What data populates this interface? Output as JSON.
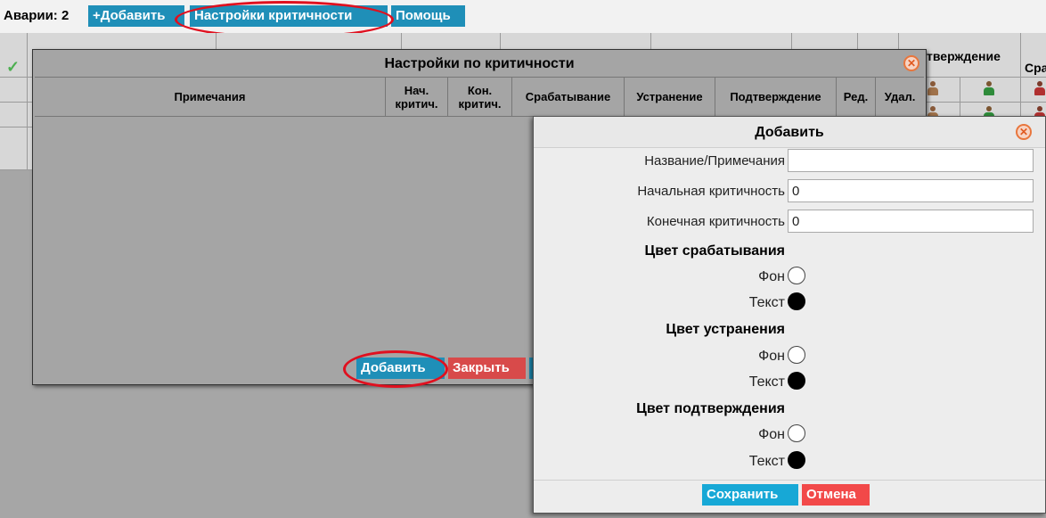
{
  "toolbar": {
    "title": "Аварии: 2",
    "add_label": "+Добавить",
    "criticality_label": "Настройки критичности",
    "help_label": "Помощь"
  },
  "background": {
    "header_fragment_confirm": "тверждение",
    "header_fragment_cra": "Сра"
  },
  "criticality_dialog": {
    "title": "Настройки по критичности",
    "columns": [
      "Примечания",
      "Нач. критич.",
      "Кон. критич.",
      "Срабатывание",
      "Устранение",
      "Подтверждение",
      "Ред.",
      "Удал."
    ],
    "add_label": "Добавить",
    "close_label": "Закрыть"
  },
  "add_dialog": {
    "title": "Добавить",
    "name_label": "Название/Примечания",
    "name_value": "",
    "start_label": "Начальная критичность",
    "start_value": "0",
    "end_label": "Конечная критичность",
    "end_value": "0",
    "sections": [
      {
        "title": "Цвет срабатывания",
        "bg_label": "Фон",
        "text_label": "Текст"
      },
      {
        "title": "Цвет устранения",
        "bg_label": "Фон",
        "text_label": "Текст"
      },
      {
        "title": "Цвет подтверждения",
        "bg_label": "Фон",
        "text_label": "Текст"
      }
    ],
    "save_label": "Сохранить",
    "cancel_label": "Отмена"
  },
  "colors": {
    "accent_blue": "#1f8fb8",
    "save_blue": "#17a8d6",
    "close_red": "#d84a4a",
    "cancel_red": "#f24949",
    "highlight_oval": "#e0101f"
  }
}
